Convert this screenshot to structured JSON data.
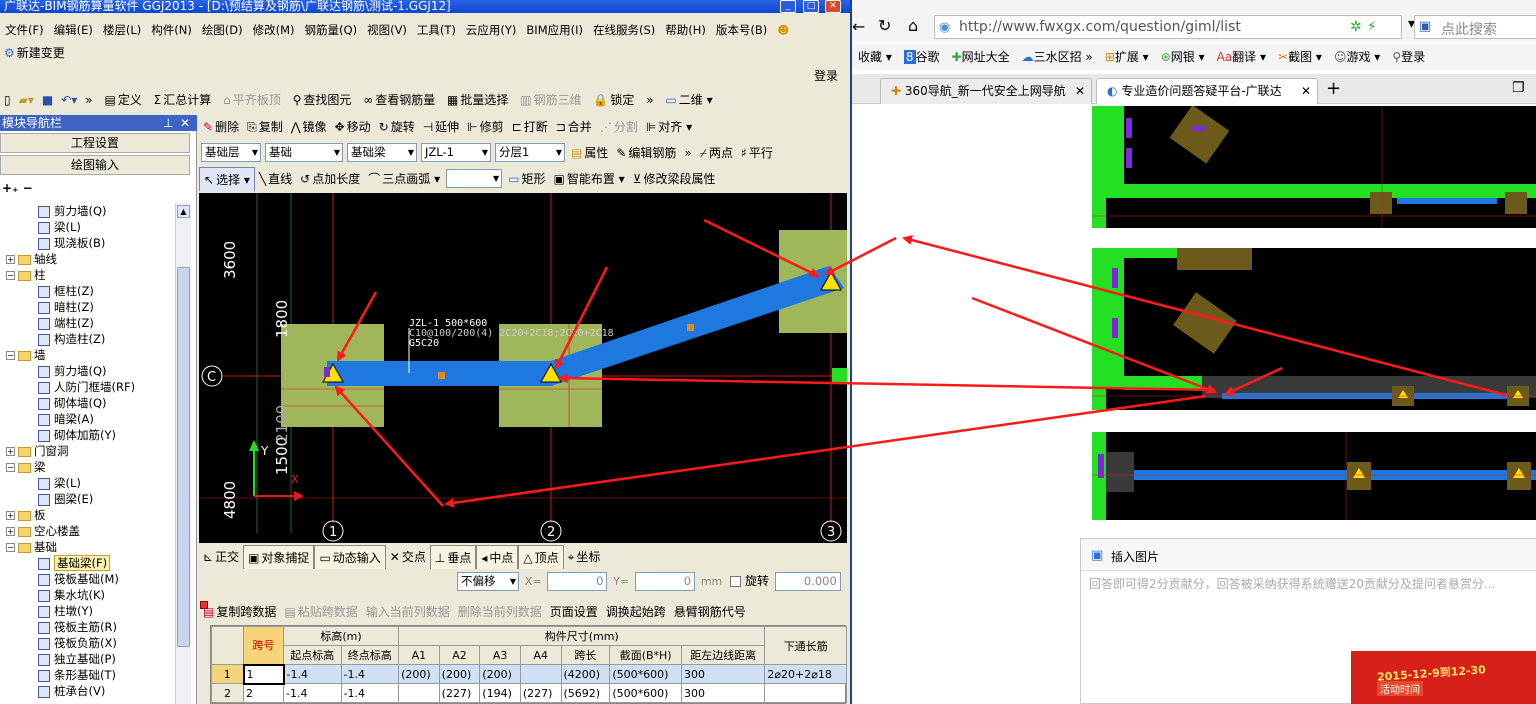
{
  "app": {
    "title": "广联达-BIM钢筋算量软件 GGJ2013 - [D:\\预结算及钢筋\\广联达钢筋\\测试-1.GGJ12]",
    "menu": [
      "文件(F)",
      "编辑(E)",
      "楼层(L)",
      "构件(N)",
      "绘图(D)",
      "修改(M)",
      "钢筋量(Q)",
      "视图(V)",
      "工具(T)",
      "云应用(Y)",
      "BIM应用(I)",
      "在线服务(S)",
      "帮助(H)",
      "版本号(B)"
    ],
    "new_change": "新建变更",
    "login": "登录",
    "toolbar1": {
      "define": "定义",
      "sum": "汇总计算",
      "flat_top": "平齐板顶",
      "find": "查找图元",
      "view_rebar": "查看钢筋量",
      "batch": "批量选择",
      "rebar3d": "钢筋三维",
      "lock": "锁定",
      "view2d": "二维"
    },
    "toolbar2": {
      "delete": "删除",
      "copy": "复制",
      "mirror": "镜像",
      "move": "移动",
      "rotate": "旋转",
      "extend": "延伸",
      "trim": "修剪",
      "break": "打断",
      "merge": "合并",
      "split": "分割",
      "align": "对齐"
    },
    "toolbar3": {
      "layer": "基础层",
      "category": "基础",
      "type": "基础梁",
      "element": "JZL-1",
      "sublayer": "分层1",
      "property": "属性",
      "edit_rebar": "编辑钢筋",
      "two_point": "两点",
      "parallel": "平行"
    },
    "toolbar4": {
      "select": "选择",
      "line": "直线",
      "point_len": "点加长度",
      "arc3": "三点画弧",
      "rect": "矩形",
      "smart": "智能布置",
      "modify_span": "修改梁段属性"
    }
  },
  "nav": {
    "title": "模块导航栏",
    "project_settings": "工程设置",
    "draw_input": "绘图输入",
    "tree": [
      {
        "label": "剪力墙(Q)",
        "level": 2
      },
      {
        "label": "梁(L)",
        "level": 2
      },
      {
        "label": "现浇板(B)",
        "level": 2
      },
      {
        "label": "轴线",
        "level": 0,
        "folder": true,
        "open": false
      },
      {
        "label": "柱",
        "level": 0,
        "folder": true,
        "open": true
      },
      {
        "label": "框柱(Z)",
        "level": 2
      },
      {
        "label": "暗柱(Z)",
        "level": 2
      },
      {
        "label": "端柱(Z)",
        "level": 2
      },
      {
        "label": "构造柱(Z)",
        "level": 2
      },
      {
        "label": "墙",
        "level": 0,
        "folder": true,
        "open": true
      },
      {
        "label": "剪力墙(Q)",
        "level": 2
      },
      {
        "label": "人防门框墙(RF)",
        "level": 2
      },
      {
        "label": "砌体墙(Q)",
        "level": 2
      },
      {
        "label": "暗梁(A)",
        "level": 2
      },
      {
        "label": "砌体加筋(Y)",
        "level": 2
      },
      {
        "label": "门窗洞",
        "level": 0,
        "folder": true,
        "open": false
      },
      {
        "label": "梁",
        "level": 0,
        "folder": true,
        "open": true
      },
      {
        "label": "梁(L)",
        "level": 2
      },
      {
        "label": "圈梁(E)",
        "level": 2
      },
      {
        "label": "板",
        "level": 0,
        "folder": true,
        "open": false
      },
      {
        "label": "空心楼盖",
        "level": 0,
        "folder": true,
        "open": false
      },
      {
        "label": "基础",
        "level": 0,
        "folder": true,
        "open": true
      },
      {
        "label": "基础梁(F)",
        "level": 2,
        "selected": true
      },
      {
        "label": "筏板基础(M)",
        "level": 2
      },
      {
        "label": "集水坑(K)",
        "level": 2
      },
      {
        "label": "柱墩(Y)",
        "level": 2
      },
      {
        "label": "筏板主筋(R)",
        "level": 2
      },
      {
        "label": "筏板负筋(X)",
        "level": 2
      },
      {
        "label": "独立基础(P)",
        "level": 2
      },
      {
        "label": "条形基础(T)",
        "level": 2
      },
      {
        "label": "桩承台(V)",
        "level": 2
      }
    ]
  },
  "canvas": {
    "dims_left": [
      "3600",
      "1800",
      "1500",
      "4800"
    ],
    "dim_overlap": "2100",
    "axis_c": "C",
    "axis_nums": [
      "1",
      "2",
      "3"
    ],
    "beam_label": [
      "JZL-1 500*600",
      "C10@100/200(4) 2C20+2C18;2C20+2C18",
      "G5C20"
    ],
    "ucs_y": "Y",
    "ucs_x": "X"
  },
  "snapbar": {
    "ortho": "正交",
    "snap": "对象捕捉",
    "dyn": "动态输入",
    "intersect": "交点",
    "perp": "垂点",
    "mid": "中点",
    "vertex": "顶点",
    "coord": "坐标"
  },
  "coordbar": {
    "offset": "不偏移",
    "x_label": "X=",
    "x_val": "0",
    "y_label": "Y=",
    "y_val": "0",
    "unit": "mm",
    "rotate": "旋转",
    "rotate_val": "0.000"
  },
  "gridbar": {
    "copy": "复制跨数据",
    "paste": "粘贴跨数据",
    "input_col": "输入当前列数据",
    "del_col": "删除当前列数据",
    "page": "页面设置",
    "swap": "调换起始跨",
    "cant": "悬臂钢筋代号"
  },
  "table": {
    "headers": {
      "span": "跨号",
      "elev": "标高(m)",
      "start": "起点标高",
      "end": "终点标高",
      "dims": "构件尺寸(mm)",
      "a1": "A1",
      "a2": "A2",
      "a3": "A3",
      "a4": "A4",
      "len": "跨长",
      "sect": "截面(B*H)",
      "dist": "距左边线距离",
      "bot": "下通长筋"
    },
    "rows": [
      {
        "n": "1",
        "span": "1",
        "start": "-1.4",
        "end": "-1.4",
        "a1": "(200)",
        "a2": "(200)",
        "a3": "(200)",
        "a4": "",
        "len": "(4200)",
        "sect": "(500*600)",
        "dist": "300",
        "bot": "2⌀20+2⌀18"
      },
      {
        "n": "2",
        "span": "2",
        "start": "-1.4",
        "end": "-1.4",
        "a1": "",
        "a2": "(227)",
        "a3": "(194)",
        "a4": "(227)",
        "len": "(5692)",
        "sect": "(500*600)",
        "dist": "300",
        "bot": ""
      }
    ]
  },
  "browser": {
    "url": "http://www.fwxgx.com/question/giml/list",
    "search_placeholder": "点此搜索",
    "favorites": [
      "收藏",
      "谷歌",
      "网址大全",
      "三水区招",
      "扩展",
      "网银",
      "翻译",
      "截图",
      "游戏",
      "登录"
    ],
    "tabs": [
      "360导航_新一代安全上网导航",
      "专业造价问题答疑平台-广联达"
    ],
    "insert_image": "插入图片",
    "answer_hint": "回答即可得2分贡献分，回答被采纳获得系统赠送20贡献分及提问者悬赏分...",
    "ad_dates": "2015-12-9到12-30",
    "ad_sub": "活动时间"
  },
  "colors": {
    "beam": "#1e78e0",
    "column": "#9fb65a",
    "wall": "#23e023",
    "arrow": "#ff1a1a",
    "axis": "#d01a1a"
  }
}
